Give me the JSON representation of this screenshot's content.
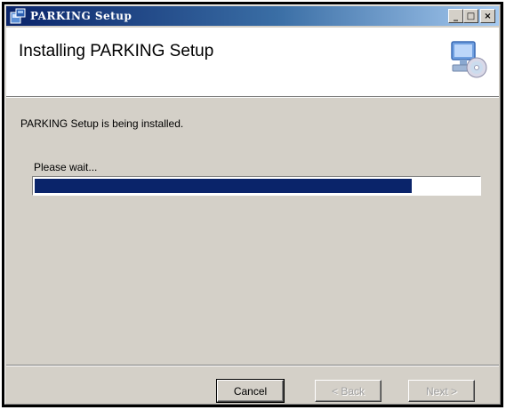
{
  "window": {
    "title": "PARKING Setup",
    "controls": {
      "minimize": "_",
      "maximize": "□",
      "close": "×"
    }
  },
  "header": {
    "title": "Installing PARKING Setup",
    "icon": "computer-cd-icon"
  },
  "body": {
    "status": "PARKING Setup is being installed.",
    "wait_label": "Please wait...",
    "progress_fraction": 0.85
  },
  "buttons": {
    "cancel": "Cancel",
    "back": "< Back",
    "next": "Next >"
  },
  "colors": {
    "progress": "#0a246a",
    "face": "#d4d0c8"
  }
}
